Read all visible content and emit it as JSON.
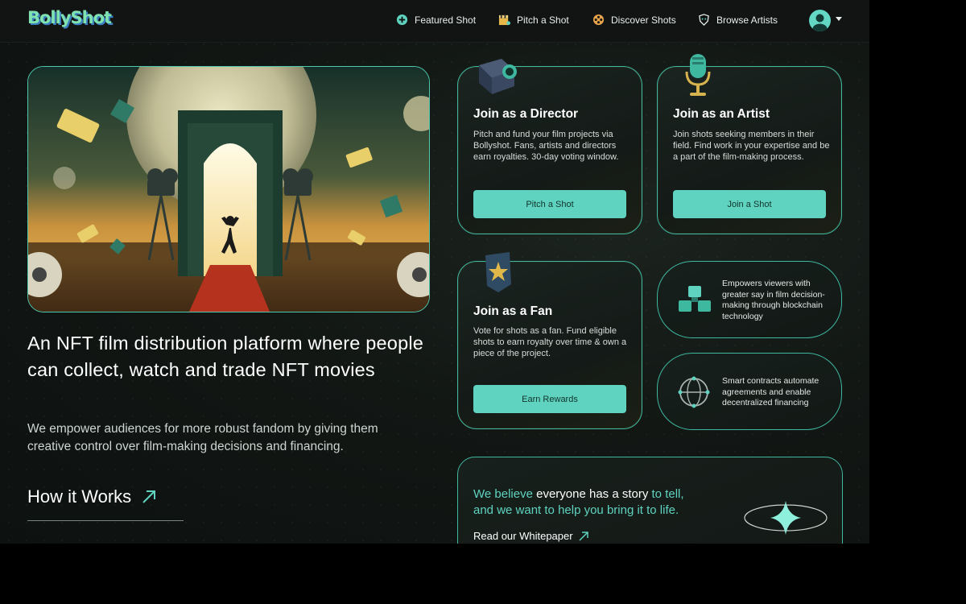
{
  "brand": {
    "logo_text": "BollyShot"
  },
  "nav": {
    "items": [
      {
        "label": "Featured Shot",
        "icon": "plus-circle-icon"
      },
      {
        "label": "Pitch a Shot",
        "icon": "clapperboard-icon"
      },
      {
        "label": "Discover Shots",
        "icon": "film-reel-icon"
      },
      {
        "label": "Browse Artists",
        "icon": "mask-shield-icon"
      }
    ],
    "profile_icon": "user-avatar-icon"
  },
  "hero": {
    "headline": "An NFT film distribution platform where people can collect, watch and trade NFT movies",
    "subtext": "We empower audiences for more robust fandom by giving them creative control over film-making decisions and financing.",
    "how_it_works": "How it Works"
  },
  "cards": {
    "director": {
      "title": "Join as a Director",
      "text": "Pitch and fund your film projects via Bollyshot. Fans, artists and directors earn royalties. 30-day voting window.",
      "button": "Pitch a Shot",
      "icon": "camera-cube-icon"
    },
    "artist": {
      "title": "Join as an Artist",
      "text": "Join shots seeking members in their field. Find work in your expertise and be a part of the film-making process.",
      "button": "Join a Shot",
      "icon": "microphone-icon"
    },
    "fan": {
      "title": "Join as a Fan",
      "text": "Vote for shots as a fan. Fund eligible shots to earn royalty over time & own a piece of the project.",
      "button": "Earn Rewards",
      "icon": "star-badge-icon"
    }
  },
  "features": [
    {
      "text": "Empowers viewers with greater say in film decision-making through blockchain technology",
      "icon": "blocks-icon"
    },
    {
      "text": "Smart contracts automate agreements and enable decentralized financing",
      "icon": "globe-network-icon"
    }
  ],
  "belief": {
    "part1": "We believe",
    "part2": " everyone has a story ",
    "part3": "to tell,",
    "part4": "and we want to help you bring it to life.",
    "link": "Read our Whitepaper"
  },
  "colors": {
    "accent": "#5fd3bf",
    "border": "#3fb8a0",
    "background": "#121714"
  }
}
